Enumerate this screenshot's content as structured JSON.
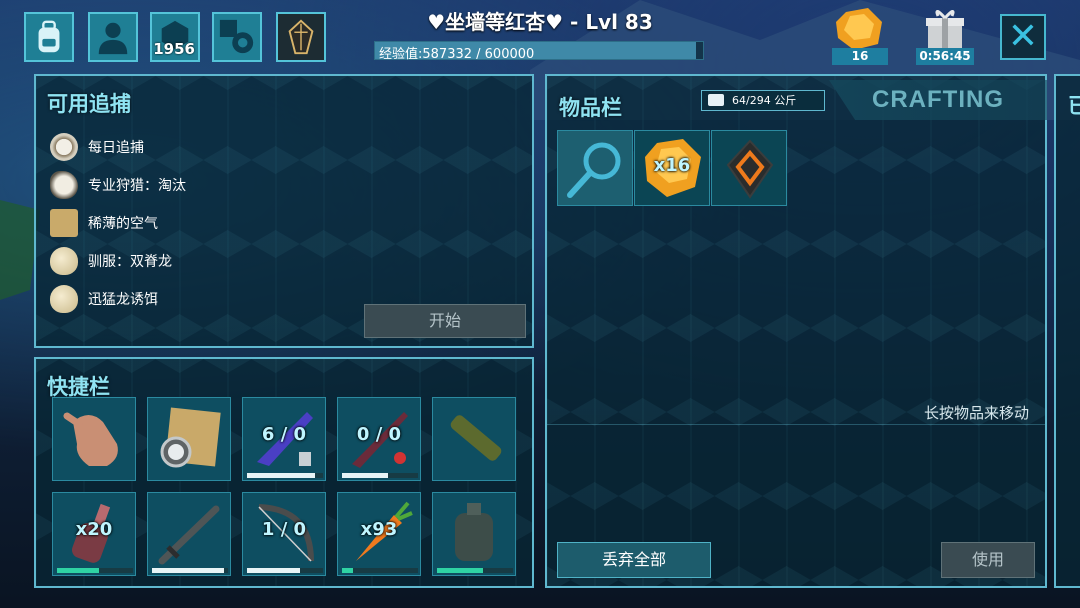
{
  "topbar": {
    "buttons": [
      {
        "name": "inventory-button",
        "icon": "backpack-icon"
      },
      {
        "name": "character-button",
        "icon": "person-icon"
      },
      {
        "name": "engrams-button",
        "icon": "cube-icon",
        "count": "1956"
      },
      {
        "name": "settings-button",
        "icon": "gear-icon"
      },
      {
        "name": "tribe-button",
        "icon": "crystal-emblem-icon"
      }
    ],
    "player_name": "♥坐墙等红杏♥ - Lvl 83",
    "xp_label": "经验值:587332 / 600000",
    "xp_current": 587332,
    "xp_max": 600000,
    "amber_count": "16",
    "gift_timer": "0:56:45",
    "close_icon": "close-x-icon"
  },
  "quests": {
    "title": "可用追捕",
    "items": [
      {
        "label": "每日追捕",
        "icon": "clock-icon"
      },
      {
        "label": "专业狩猎：淘汰",
        "icon": "dino-skull-icon"
      },
      {
        "label": "稀薄的空气",
        "icon": "map-icon"
      },
      {
        "label": "驯服：双脊龙",
        "icon": "egg-icon"
      },
      {
        "label": "迅猛龙诱饵",
        "icon": "egg-icon"
      }
    ],
    "start_label": "开始"
  },
  "hotbar": {
    "title": "快捷栏",
    "slots": [
      {
        "item": "hand-icon",
        "count": "",
        "durability": null
      },
      {
        "item": "map-compass-icon",
        "count": "",
        "durability": null
      },
      {
        "item": "tek-rifle-icon",
        "count": "6 / 0",
        "durability": 0.9
      },
      {
        "item": "shotgun-icon",
        "count": "0 / 0",
        "durability": 0.6
      },
      {
        "item": "spyglass-icon",
        "count": "",
        "durability": null
      },
      {
        "item": "potion-bottle-icon",
        "count": "x20",
        "durability": 0.55
      },
      {
        "item": "sword-icon",
        "count": "",
        "durability": 0.95
      },
      {
        "item": "bow-icon",
        "count": "1 / 0",
        "durability": 0.7
      },
      {
        "item": "carrot-icon",
        "count": "x93",
        "durability": 0.15
      },
      {
        "item": "backpack-armor-icon",
        "count": "",
        "durability": 0.6
      }
    ]
  },
  "inventory": {
    "title": "物品栏",
    "weight": "64/294 公斤",
    "crafting_tab": "CRAFTING",
    "slots": [
      {
        "item": "search-magnifier-icon",
        "count": ""
      },
      {
        "item": "amber-icon",
        "count": "x16"
      },
      {
        "item": "element-shard-icon",
        "count": ""
      }
    ],
    "hint": "长按物品来移动",
    "drop_all_label": "丢弃全部",
    "use_label": "使用"
  },
  "edge_panel": {
    "char": "已"
  },
  "colors": {
    "accent": "#5fb8cf",
    "title": "#8fe3f2",
    "durability_good": "#2fd3a4",
    "durability_white": "#e8f4f6"
  }
}
